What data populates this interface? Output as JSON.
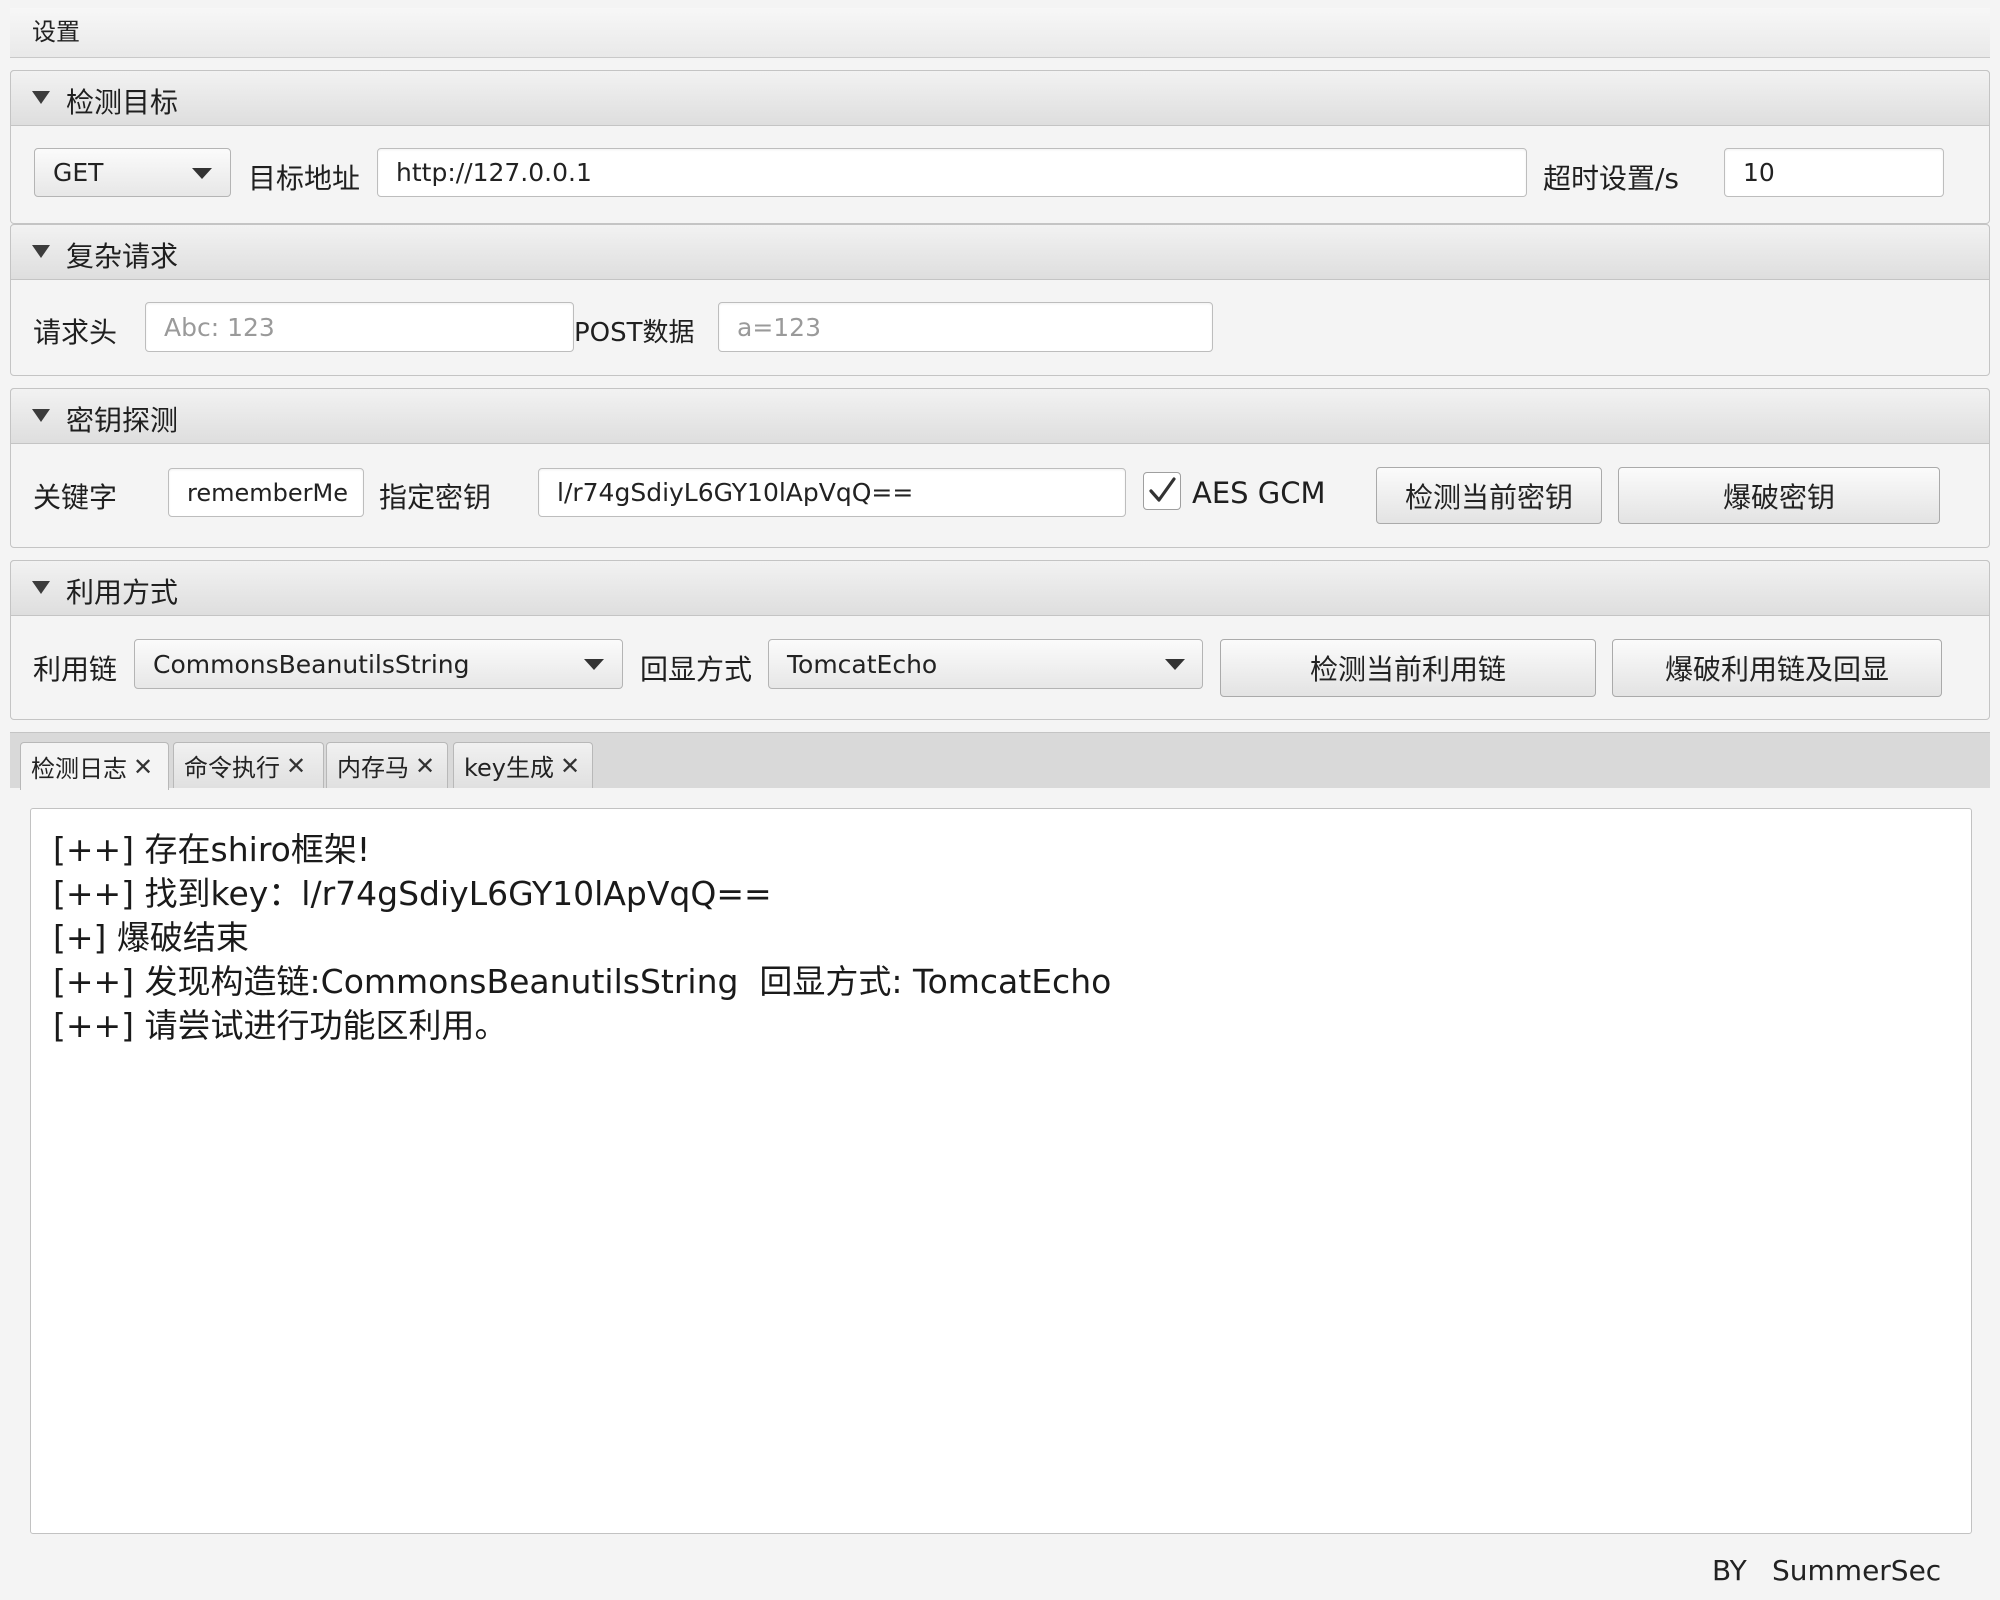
{
  "menu": {
    "settings": "设置"
  },
  "target": {
    "title": "检测目标",
    "method": "GET",
    "url_label": "目标地址",
    "url_value": "http://127.0.0.1",
    "timeout_label": "超时设置/s",
    "timeout_value": "10"
  },
  "complex": {
    "title": "复杂请求",
    "header_label": "请求头",
    "header_placeholder": "Abc: 123",
    "post_label": "POST数据",
    "post_placeholder": "a=123"
  },
  "key": {
    "title": "密钥探测",
    "keyword_label": "关键字",
    "keyword_value": "rememberMe",
    "specify_label": "指定密钥",
    "specify_value": "l/r74gSdiyL6GY10lApVqQ==",
    "gcm_label": "AES GCM",
    "gcm_checked": true,
    "check_button": "检测当前密钥",
    "brute_button": "爆破密钥"
  },
  "exploit": {
    "title": "利用方式",
    "chain_label": "利用链",
    "chain_value": "CommonsBeanutilsString",
    "echo_label": "回显方式",
    "echo_value": "TomcatEcho",
    "check_button": "检测当前利用链",
    "brute_button": "爆破利用链及回显"
  },
  "tabs": [
    {
      "label": "检测日志"
    },
    {
      "label": "命令执行"
    },
    {
      "label": "内存马"
    },
    {
      "label": "key生成"
    }
  ],
  "tab_close_glyph": "✕",
  "log": [
    "[++] 存在shiro框架!",
    "[++] 找到key：l/r74gSdiyL6GY10lApVqQ==",
    "[+] 爆破结束",
    "[++] 发现构造链:CommonsBeanutilsString  回显方式: TomcatEcho",
    "[++] 请尝试进行功能区利用。"
  ],
  "footer": {
    "by": "BY",
    "author": "SummerSec"
  }
}
